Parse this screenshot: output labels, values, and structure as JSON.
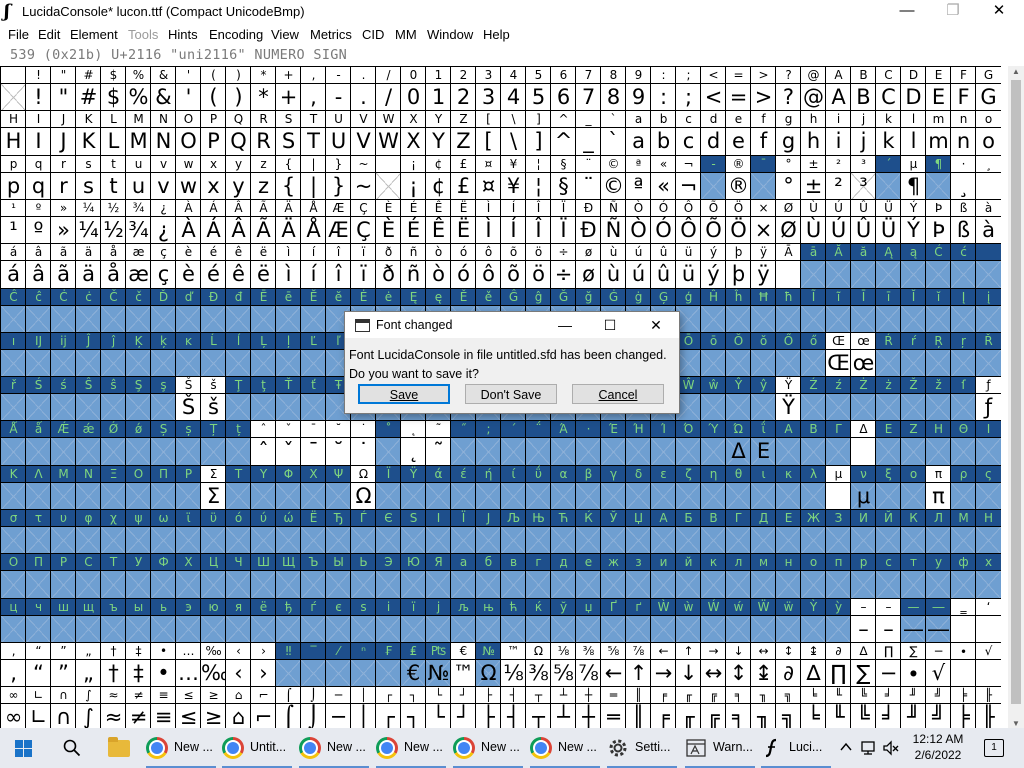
{
  "window": {
    "title": "LucidaConsole* lucon.ttf (Compact UnicodeBmp)",
    "minimize": "—",
    "restore": "❐",
    "close": "✕"
  },
  "menubar": [
    {
      "label": "File",
      "disabled": false
    },
    {
      "label": "Edit",
      "disabled": false
    },
    {
      "label": "Element",
      "disabled": false
    },
    {
      "label": "Tools",
      "disabled": true
    },
    {
      "label": "Hints",
      "disabled": false
    },
    {
      "label": "Encoding",
      "disabled": false
    },
    {
      "label": "View",
      "disabled": false
    },
    {
      "label": "Metrics",
      "disabled": false
    },
    {
      "label": "CID",
      "disabled": false
    },
    {
      "label": "MM",
      "disabled": false
    },
    {
      "label": "Window",
      "disabled": false
    },
    {
      "label": "Help",
      "disabled": false
    }
  ],
  "info_line": "539 (0x21b) U+2116 \"uni2116\" NUMERO SIGN",
  "glyph_rows": [
    {
      "labels": " !\"#$%&'()*+,-./0123456789:;<=>?@ABCDEFG",
      "glyphs": " !\"#$%&'()*+,-./0123456789:;<=>?@ABCDEFG",
      "empty": [
        0
      ],
      "sel": []
    },
    {
      "labels": "HIJKLMNOPQRSTUVWXYZ[\\]^_`abcdefghijklmno",
      "glyphs": "HIJKLMNOPQRSTUVWXYZ[\\]^_`abcdefghijklmno",
      "empty": [],
      "sel": []
    },
    {
      "labels": "pqrstuvwxyz{|}~ ¡¢£¤¥¦§¨©ª«¬-®¯°±²³´µ¶·¸",
      "glyphs": "pqrstuvwxyz{|}~ ¡¢£¤¥¦§¨©ª«¬ ® °±²³ ¶ ¸",
      "empty": [
        15,
        28,
        30,
        34,
        35,
        37
      ],
      "sel": [
        28,
        30,
        35,
        37
      ]
    },
    {
      "labels": "¹º»¼½¾¿ÀÁÂÃÄÅÆÇÈÉÊËÌÍÎÏÐÑÒÓÔÕÖ×ØÙÚÛÜÝÞßà",
      "glyphs": "¹º»¼½¾¿ÀÁÂÃÄÅÆÇÈÉÊËÌÍÎÏÐÑÒÓÔÕÖ×ØÙÚÛÜÝÞßà",
      "empty": [],
      "sel": []
    },
    {
      "labels": "áâãäåæçèéêëìíîïðñòóôõö÷øùúûüýþÿĀāĂăĄąĆć",
      "glyphs": "áâãäåæçèéêëìíîïðñòóôõö÷øùúûüýþÿ        ",
      "empty": [
        32,
        33,
        34,
        35,
        36,
        37,
        38,
        39
      ],
      "sel": [
        32,
        33,
        34,
        35,
        36,
        37,
        38,
        39
      ]
    },
    {
      "labels": "ĈĉĊċČčĎďĐđĒēĔĕĖėĘęĚěĜĝĞğĠġĢģĤĥĦħĨĩĪīĬĭĮį",
      "glyphs": "                                        ",
      "empty": "all",
      "sel": "all"
    },
    {
      "labels": "ıĲĳĴĵĶķĸĹĺĻļĽľĿŀŁłŃńŅņŇňŉŊŋŌōŎŏŐőŒœŔŕŖŗŘ",
      "glyphs": "                                 Œœ     ",
      "empty": "allbut",
      "keep": [
        33,
        34
      ],
      "sel": "allbut"
    },
    {
      "labels": "řŚśŜŝŞşŠšŢţŤťŦŧŨũŪūŬŭŮůŰűŲųŴŵŶŷŸŹźŻżŽžſƒ",
      "glyphs": "       Šš                      Ÿ       ƒ",
      "empty": "allbut",
      "keep": [
        7,
        8,
        31,
        39
      ],
      "sel": "allbut"
    },
    {
      "labels": "ǺǻǼǽǾǿȘșȚțˆˇˉ˘˙˚˛˜˝;΄΅Ά·ΈΉΊΌΎΏΐΑΒΓΔΕΖΗΘΙ",
      "glyphs": "          ˆˇˉ˘˙ ˛˜           ΔΕ",
      "empty": "allbut",
      "keep": [
        10,
        11,
        12,
        13,
        14,
        16,
        17,
        34
      ],
      "sel": "allbut"
    },
    {
      "labels": "ΚΛΜΝΞΟΠΡΣΤΥΦΧΨΩΪΫάέήίΰαβγδεζηθικλμνξοπρς",
      "glyphs": "        Σ     Ω                   μ  π",
      "empty": "allbut",
      "keep": [
        8,
        14,
        33,
        37
      ],
      "sel": "allbut"
    },
    {
      "labels": "στυφχψωϊϋόύώЁЂЃЄЅІЇЈЉЊЋЌЎЏАБВГДЕЖЗИЙКЛМН",
      "glyphs": "                                        ",
      "empty": "all",
      "sel": "all"
    },
    {
      "labels": "ОПРСТУФХЦЧШЩЪЫЬЭЮЯабвгдежзийклмнопрстуфх",
      "glyphs": "                                        ",
      "empty": "all",
      "sel": "all"
    },
    {
      "labels": "цчшщъыьэюяёђѓєѕіїјљњћќўџҐґẀẁẂẃẄẅỲỳ––—―‗‘’",
      "glyphs": "                                  ––—―  ‘’",
      "empty": "allbut",
      "keep": [
        34,
        35,
        38,
        39
      ],
      "sel": "allbut"
    },
    {
      "labels": "‚“”„†‡•…‰‹›‼‾⁄ⁿ₣₤₧€№™Ω⅛⅜⅝⅞←↑→↓↔↕↨∂∆∏∑−∙√",
      "glyphs": "‚“”„†‡•…‰‹›     €№™Ω⅛⅜⅝⅞←↑→↓↔↕↨∂∆∏∑−∙√",
      "empty": [
        11,
        12,
        13,
        14,
        15,
        16,
        17,
        19
      ],
      "sel": [
        11,
        12,
        13,
        14,
        15,
        16,
        17,
        19
      ]
    },
    {
      "labels": "∞∟∩∫≈≠≡≤≥⌂⌐⌠⌡─│┌┐└┘├┤┬┴┼═║╒╓╔╕╖╗╘╙╚╛╜╝╞╟",
      "glyphs": "∞∟∩∫≈≠≡≤≥⌂⌐⌠⌡─│┌┐└┘├┤┬┴┼═║╒╓╔╕╖╗╘╙╚╛╜╝╞╟",
      "empty": [],
      "sel": []
    }
  ],
  "dialog": {
    "title": "Font changed",
    "message_line1": "Font LucidaConsole in file untitled.sfd has been changed.",
    "message_line2": "Do you want to save it?",
    "save": "Save",
    "dont_save": "Don't Save",
    "cancel": "Cancel"
  },
  "taskbar": {
    "items": [
      {
        "label": "New ...",
        "icon": "chrome-icon"
      },
      {
        "label": "Untit...",
        "icon": "chrome-icon"
      },
      {
        "label": "New ...",
        "icon": "chrome-icon"
      },
      {
        "label": "New ...",
        "icon": "chrome-icon"
      },
      {
        "label": "New ...",
        "icon": "chrome-icon"
      },
      {
        "label": "New ...",
        "icon": "chrome-icon"
      },
      {
        "label": "Setti...",
        "icon": "gear-icon"
      },
      {
        "label": "Warn...",
        "icon": "warning-icon"
      },
      {
        "label": "Luci...",
        "icon": "fontforge-icon"
      }
    ],
    "time": "12:12 AM",
    "date": "2/6/2022",
    "notification_count": "1"
  },
  "colors": {
    "selection": "#1e4f8c",
    "selection_text": "#7fd67f",
    "accent": "#0078d7"
  }
}
